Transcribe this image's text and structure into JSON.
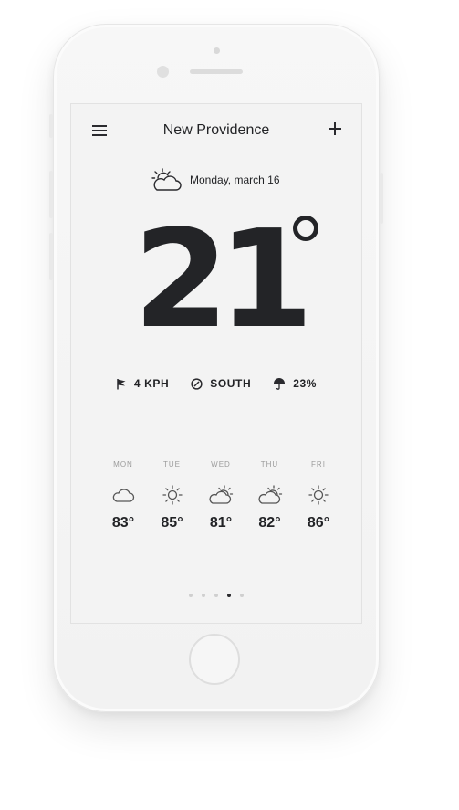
{
  "header": {
    "title": "New Providence"
  },
  "date": {
    "label": "Monday, march 16",
    "icon": "partly-cloudy-icon"
  },
  "current": {
    "temperature": "21",
    "unit_icon": "degree-icon"
  },
  "stats": [
    {
      "icon": "flag-icon",
      "value": "4 KPH"
    },
    {
      "icon": "compass-icon",
      "value": "SOUTH"
    },
    {
      "icon": "umbrella-icon",
      "value": "23%"
    }
  ],
  "forecast": [
    {
      "day": "MON",
      "icon": "cloud-icon",
      "temp": "83°"
    },
    {
      "day": "TUE",
      "icon": "sun-icon",
      "temp": "85°"
    },
    {
      "day": "WED",
      "icon": "partly-cloudy-icon",
      "temp": "81°"
    },
    {
      "day": "THU",
      "icon": "partly-cloudy-icon",
      "temp": "82°"
    },
    {
      "day": "FRI",
      "icon": "sun-icon",
      "temp": "86°"
    }
  ],
  "pager": {
    "count": 5,
    "active_index": 3
  },
  "colors": {
    "text": "#222326",
    "screen_bg": "#f3f3f3",
    "muted": "#9b9b9b",
    "dot_inactive": "#cfcfcf"
  }
}
